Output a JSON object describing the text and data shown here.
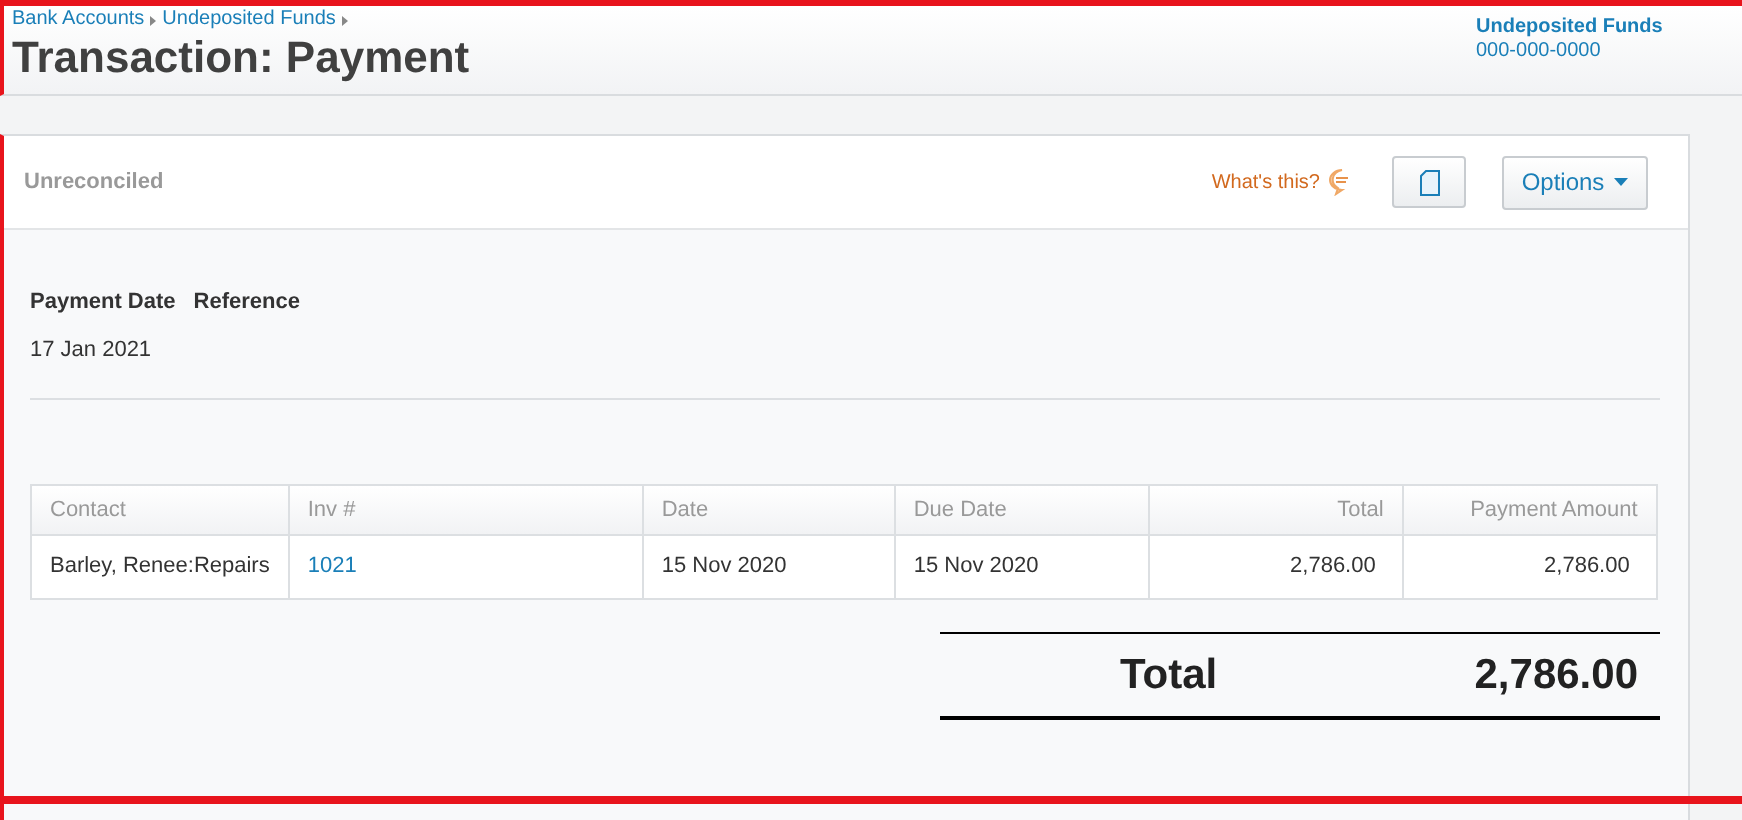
{
  "breadcrumb": [
    "Bank Accounts",
    "Undeposited Funds"
  ],
  "title": "Transaction: Payment",
  "account": {
    "name": "Undeposited Funds",
    "number": "000-000-0000"
  },
  "status": "Unreconciled",
  "help_link": "What's this?",
  "options_button": "Options",
  "details": {
    "labels": [
      "Payment Date",
      "Reference"
    ],
    "values": [
      "17 Jan 2021"
    ]
  },
  "table": {
    "columns": [
      {
        "label": "Contact",
        "kind": "text"
      },
      {
        "label": "Inv #",
        "kind": "text"
      },
      {
        "label": "Date",
        "kind": "text"
      },
      {
        "label": "Due Date",
        "kind": "text"
      },
      {
        "label": "Total",
        "kind": "amount"
      },
      {
        "label": "Payment Amount",
        "kind": "amount"
      }
    ],
    "rows": [
      [
        {
          "text": "Barley, Renee:Repairs",
          "kind": "text"
        },
        {
          "text": "1021",
          "kind": "link"
        },
        {
          "text": "15 Nov 2020",
          "kind": "text"
        },
        {
          "text": "15 Nov 2020",
          "kind": "text"
        },
        {
          "text": "2,786.00",
          "kind": "text"
        },
        {
          "text": "2,786.00",
          "kind": "text"
        }
      ]
    ]
  },
  "total": {
    "label": "Total",
    "value": "2,786.00"
  }
}
